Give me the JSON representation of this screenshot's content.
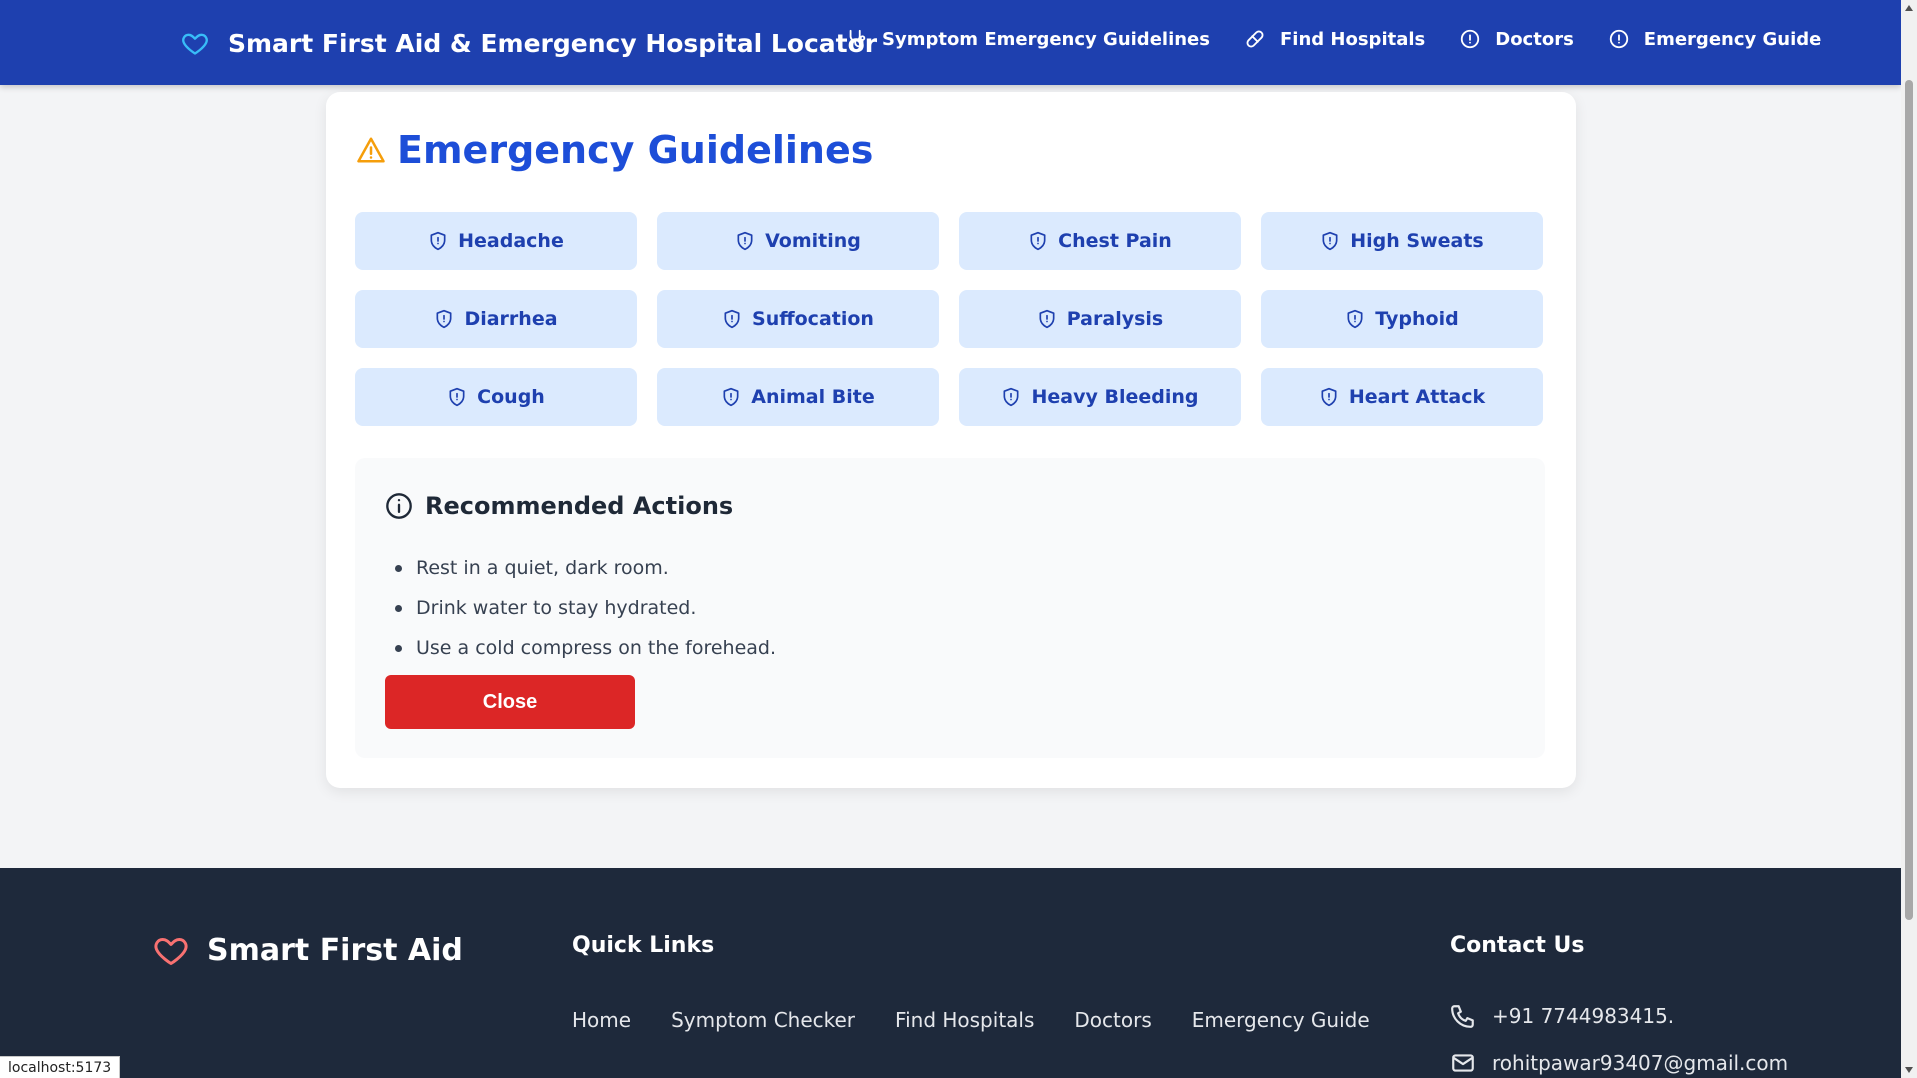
{
  "navbar": {
    "brand_icon": "heart-icon",
    "title": "Smart First Aid & Emergency Hospital Locator",
    "links": [
      {
        "label": "Symptom Emergency Guidelines",
        "icon": "stethoscope-icon"
      },
      {
        "label": "Find Hospitals",
        "icon": "pill-icon"
      },
      {
        "label": "Doctors",
        "icon": "alert-circle-icon"
      },
      {
        "label": "Emergency Guide",
        "icon": "alert-circle-icon"
      }
    ]
  },
  "guidelines": {
    "title": "Emergency Guidelines",
    "title_icon": "warning-triangle-icon",
    "symptoms": [
      "Headache",
      "Vomiting",
      "Chest Pain",
      "High Sweats",
      "Diarrhea",
      "Suffocation",
      "Paralysis",
      "Typhoid",
      "Cough",
      "Animal Bite",
      "Heavy Bleeding",
      "Heart Attack"
    ],
    "actions": {
      "title": "Recommended Actions",
      "items": [
        "Rest in a quiet, dark room.",
        "Drink water to stay hydrated.",
        "Use a cold compress on the forehead."
      ],
      "close_label": "Close"
    }
  },
  "footer": {
    "brand": "Smart First Aid",
    "quick_links_title": "Quick Links",
    "quick_links": [
      "Home",
      "Symptom Checker",
      "Find Hospitals",
      "Doctors",
      "Emergency Guide"
    ],
    "contact_title": "Contact Us",
    "phone": "+91 7744983415.",
    "email": "rohitpawar93407@gmail.com"
  },
  "status_bar": "localhost:5173",
  "colors": {
    "nav_bg": "#1e40af",
    "accent_blue": "#1d4ed8",
    "symptom_btn_bg": "#dbeafe",
    "close_red": "#dc2626",
    "warning_orange": "#f59e0b",
    "footer_bg": "#1e293b",
    "brand_heart": "#38bdf8",
    "footer_heart": "#f87171"
  }
}
